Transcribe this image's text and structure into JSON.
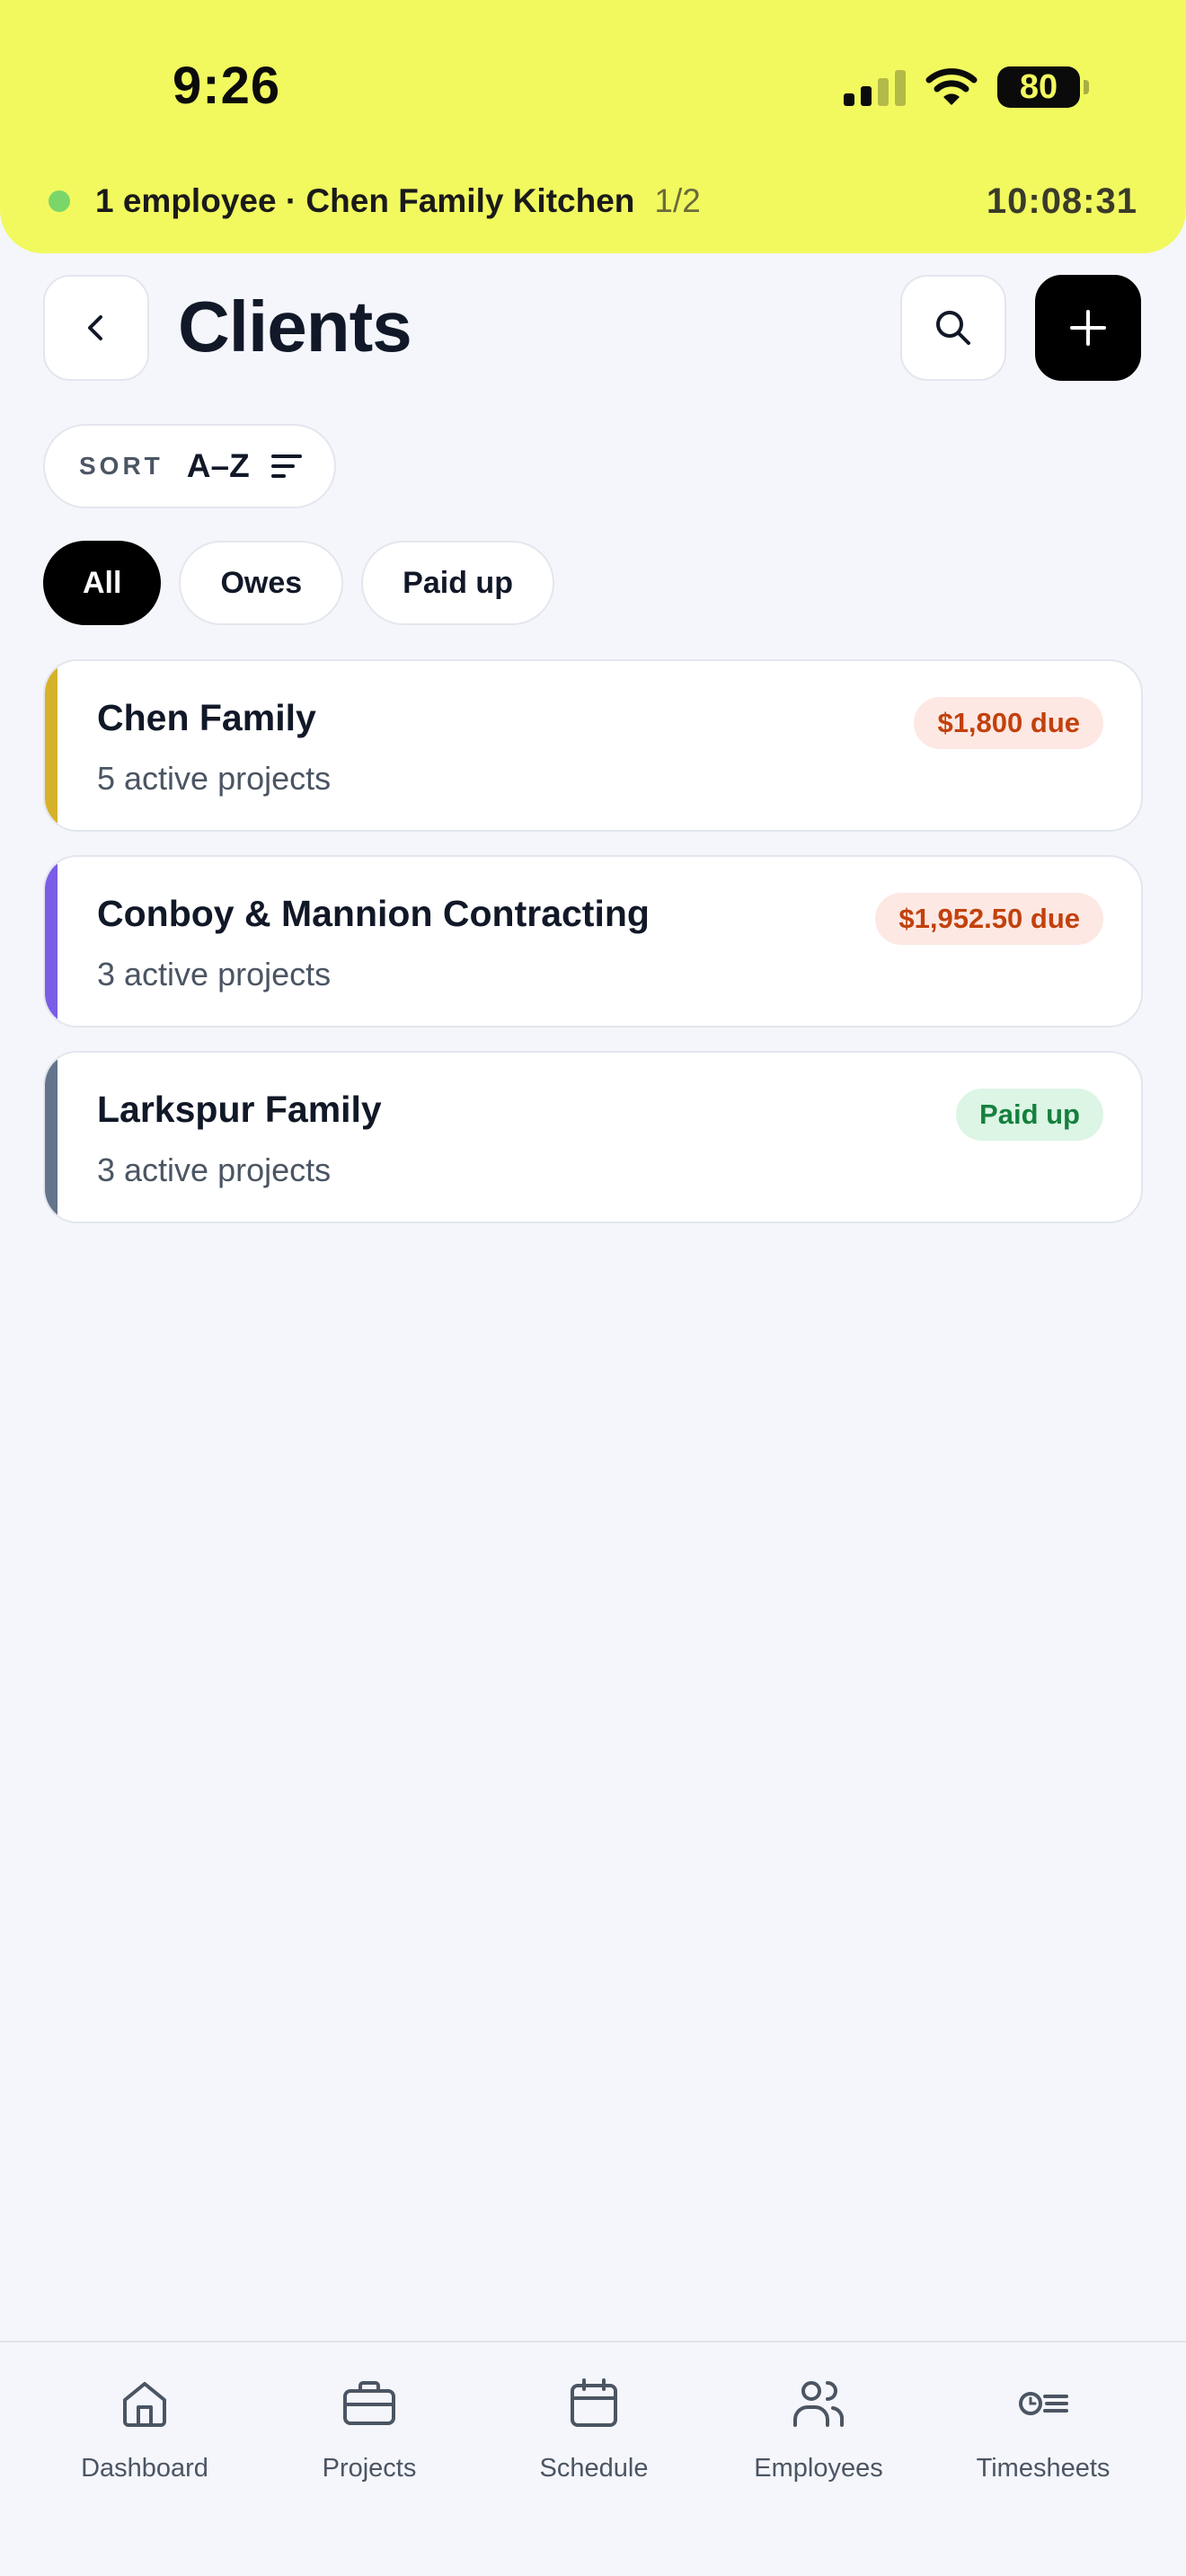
{
  "status_bar": {
    "time": "9:26",
    "battery": "80"
  },
  "live_activity": {
    "text": "1 employee · Chen Family Kitchen",
    "count": "1/2",
    "timer": "10:08:31"
  },
  "header": {
    "title": "Clients"
  },
  "sort": {
    "label": "SORT",
    "value": "A–Z"
  },
  "filters": [
    {
      "label": "All",
      "active": true
    },
    {
      "label": "Owes",
      "active": false
    },
    {
      "label": "Paid up",
      "active": false
    }
  ],
  "clients": [
    {
      "name": "Chen Family",
      "subtitle": "5 active projects",
      "badge": "$1,800 due",
      "accent": "#d6b22b",
      "badge_bg": "#fde8e3",
      "badge_fg": "#c2410c"
    },
    {
      "name": "Conboy & Mannion Contracting",
      "subtitle": "3 active projects",
      "badge": "$1,952.50 due",
      "accent": "#7a5ce6",
      "badge_bg": "#fde8e3",
      "badge_fg": "#c2410c"
    },
    {
      "name": "Larkspur Family",
      "subtitle": "3 active projects",
      "badge": "Paid up",
      "accent": "#64748b",
      "badge_bg": "#dcf5e5",
      "badge_fg": "#15803d"
    }
  ],
  "bottom_nav": [
    {
      "label": "Dashboard",
      "icon": "home-icon"
    },
    {
      "label": "Projects",
      "icon": "briefcase-icon"
    },
    {
      "label": "Schedule",
      "icon": "calendar-icon"
    },
    {
      "label": "Employees",
      "icon": "users-icon"
    },
    {
      "label": "Timesheets",
      "icon": "timesheet-icon"
    }
  ],
  "colors": {
    "header_bg": "#f1f95f",
    "page_bg": "#f4f6fb",
    "live_dot": "#7bd66a"
  }
}
